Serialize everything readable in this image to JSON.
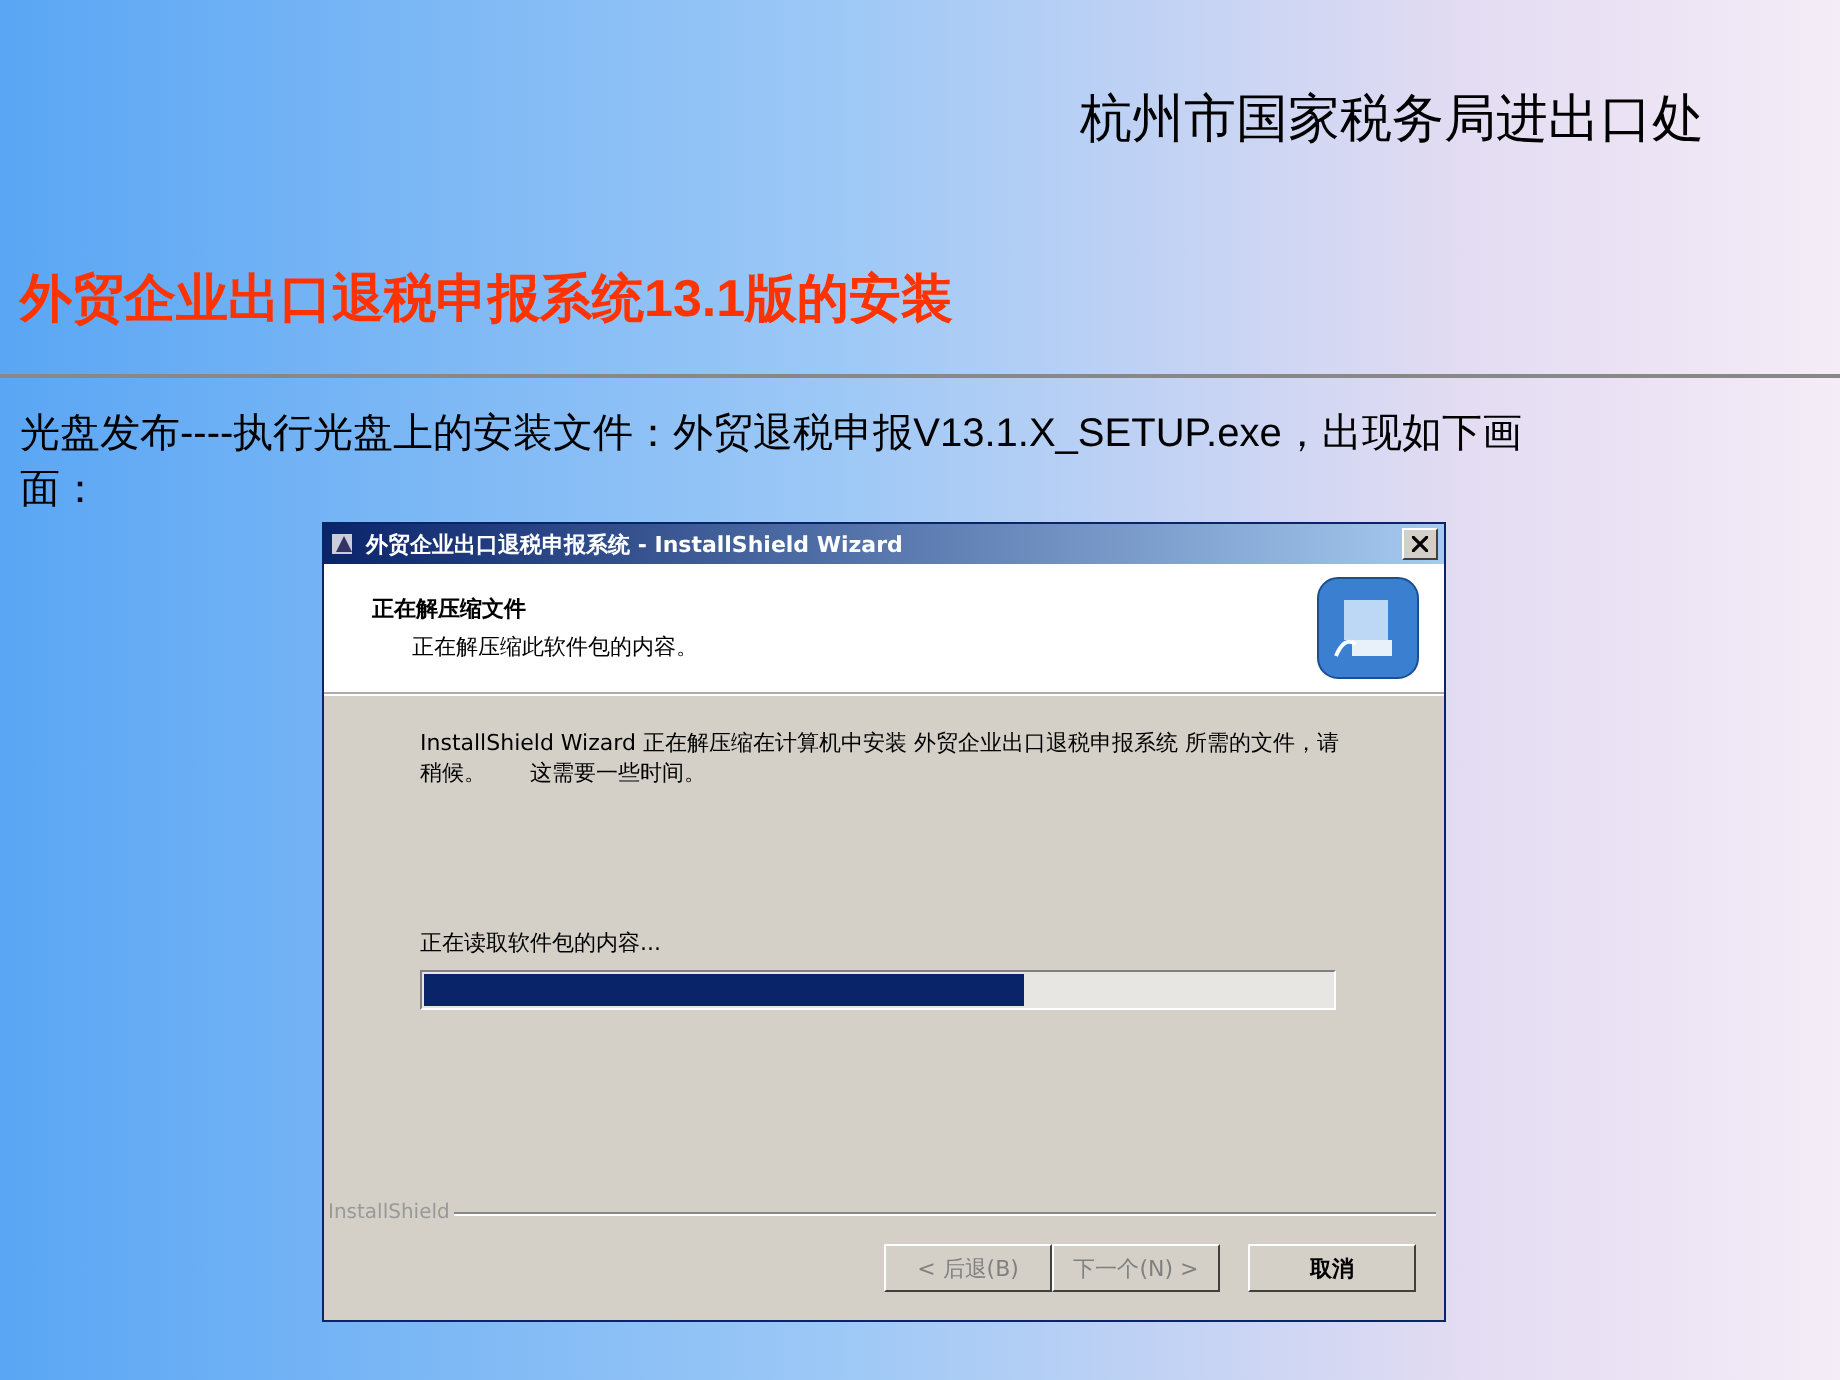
{
  "header": "杭州市国家税务局进出口处",
  "title": "外贸企业出口退税申报系统13.1版的安装",
  "paragraph": "光盘发布----执行光盘上的安装文件：外贸退税申报V13.1.X_SETUP.exe，出现如下画面：",
  "dialog": {
    "title": "外贸企业出口退税申报系统 - InstallShield Wizard",
    "heading": "正在解压缩文件",
    "subheading": "正在解压缩此软件包的内容。",
    "message": "InstallShield Wizard 正在解压缩在计算机中安装 外贸企业出口退税申报系统 所需的文件，请稍候。　　这需要一些时间。",
    "status": "正在读取软件包的内容...",
    "progress": {
      "level": 0.66
    },
    "brand": "InstallShield",
    "buttons": [
      {
        "label": "< 后退(B)",
        "disabled": true
      },
      {
        "label": "下一个(N) >",
        "disabled": true
      },
      {
        "label": "取消",
        "disabled": false
      }
    ]
  }
}
